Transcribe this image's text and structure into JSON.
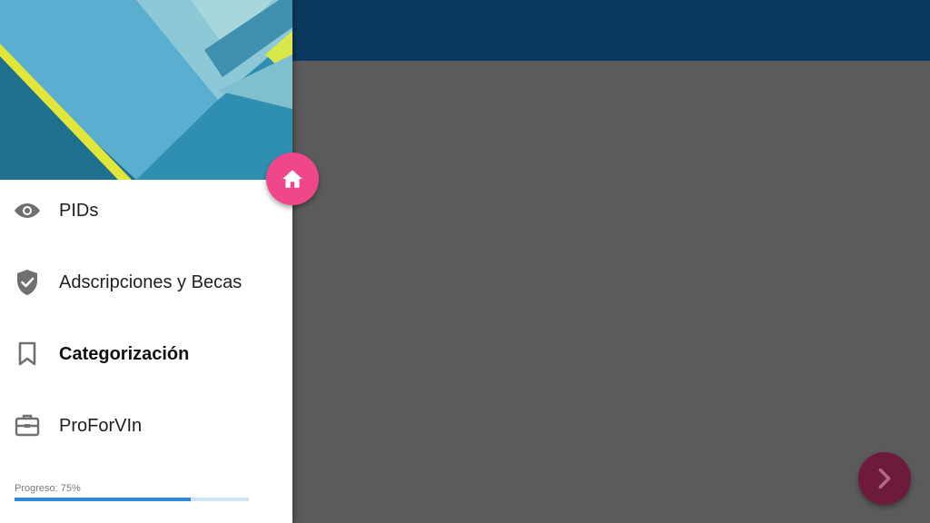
{
  "colors": {
    "appbar": "#0b3a5e",
    "content": "#5b5b5b",
    "accent_home": "#f0478a",
    "accent_next": "#6d1a3c",
    "progress_fill": "#2d8ad8",
    "progress_track": "#cfe6f7"
  },
  "drawer": {
    "items": [
      {
        "label": "PIDs",
        "icon": "eye-icon",
        "active": false
      },
      {
        "label": "Adscripciones y Becas",
        "icon": "verified-shield-icon",
        "active": false
      },
      {
        "label": "Categorización",
        "icon": "bookmark-icon",
        "active": true
      },
      {
        "label": "ProForVIn",
        "icon": "briefcase-icon",
        "active": false
      }
    ],
    "progress": {
      "label": "Progreso: 75%",
      "value": 0.75
    }
  },
  "buttons": {
    "home_icon": "home-icon",
    "next_icon": "chevron-right-icon"
  }
}
